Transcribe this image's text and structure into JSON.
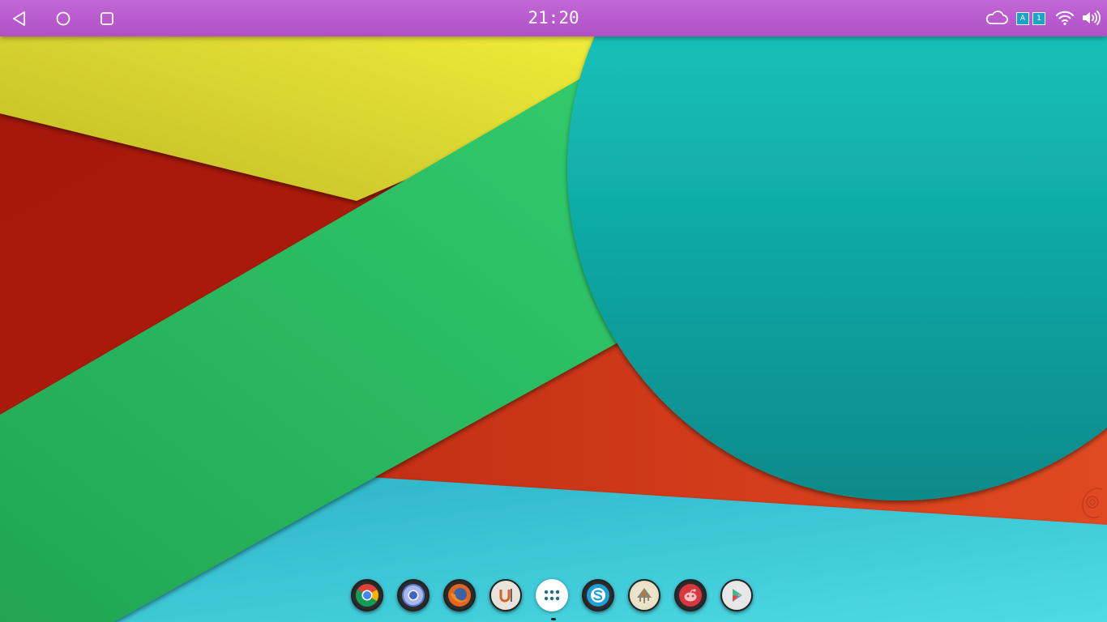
{
  "statusbar": {
    "time": "21:20",
    "nav": {
      "back": "back-icon",
      "home": "home-icon",
      "recents": "recents-icon"
    },
    "tray": {
      "cloud": "cloud-icon",
      "keyboard_indicators": [
        "A",
        "1"
      ],
      "wifi": "wifi-icon",
      "volume": "volume-icon"
    },
    "bar_color": "#b85acb"
  },
  "dock": {
    "apps": [
      {
        "name": "chrome",
        "icon": "chrome-icon"
      },
      {
        "name": "chromium",
        "icon": "chromium-icon"
      },
      {
        "name": "firefox",
        "icon": "firefox-icon"
      },
      {
        "name": "unity",
        "icon": "unity-icon"
      },
      {
        "name": "app-drawer",
        "icon": "app-drawer-icon"
      },
      {
        "name": "skype",
        "icon": "skype-icon"
      },
      {
        "name": "inkscape",
        "icon": "inkscape-icon"
      },
      {
        "name": "reddit",
        "icon": "reddit-icon"
      },
      {
        "name": "play-store",
        "icon": "play-store-icon"
      }
    ]
  },
  "wallpaper": {
    "colors": {
      "yellow": "#dcd830",
      "red": "#b51e0d",
      "green": "#2ebd63",
      "orange": "#d24320",
      "teal_circle": "#13b3b3",
      "cyan_bottom": "#34bccb"
    }
  }
}
